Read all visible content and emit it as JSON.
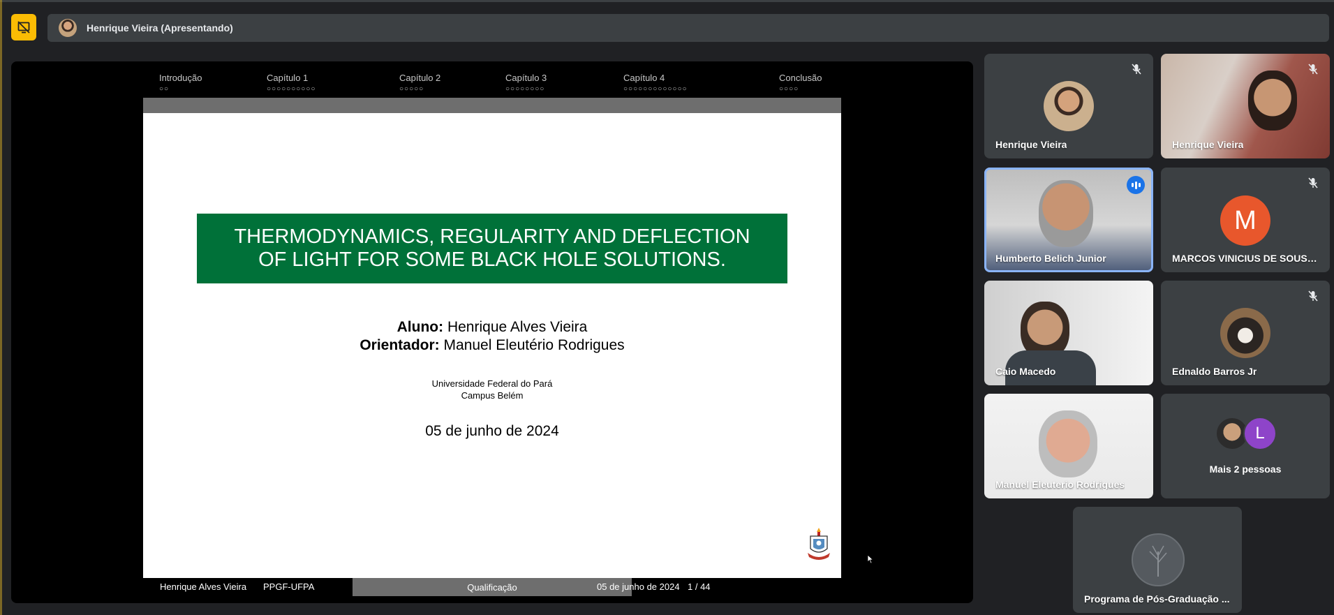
{
  "presenter": {
    "label": "Henrique Vieira (Apresentando)"
  },
  "colors": {
    "accent_yellow": "#fbbc04",
    "slide_green": "#007139",
    "active_border": "#8ab4f8",
    "speaking_blue": "#1a73e8",
    "avatar_m": "#e8572c",
    "avatar_l": "#8e44c9"
  },
  "slide": {
    "nav": [
      {
        "label": "Introdução",
        "dots": "○○"
      },
      {
        "label": "Capítulo 1",
        "dots": "○○○○○○○○○○"
      },
      {
        "label": "Capítulo 2",
        "dots": "○○○○○"
      },
      {
        "label": "Capítulo 3",
        "dots": "○○○○○○○○"
      },
      {
        "label": "Capítulo 4",
        "dots": "○○○○○○○○○○○○○"
      },
      {
        "label": "Conclusão",
        "dots": "○○○○"
      }
    ],
    "title_line1": "THERMODYNAMICS, REGULARITY AND DEFLECTION",
    "title_line2": "OF LIGHT FOR SOME BLACK HOLE SOLUTIONS.",
    "aluno_label": "Aluno:",
    "aluno_name": "Henrique Alves Vieira",
    "orientador_label": "Orientador:",
    "orientador_name": "Manuel Eleutério Rodrigues",
    "university": "Universidade Federal do Pará",
    "campus": "Campus Belém",
    "date": "05 de junho de 2024",
    "footer": {
      "author": "Henrique Alves Vieira",
      "program": "PPGF-UFPA",
      "section": "Qualificação",
      "date": "05 de junho de 2024",
      "page": "1 / 44"
    }
  },
  "participants": [
    {
      "name": "Henrique Vieira",
      "muted": true
    },
    {
      "name": "Henrique Vieira",
      "muted": true
    },
    {
      "name": "Humberto Belich Junior",
      "speaking": true
    },
    {
      "name": "MARCOS VINICIUS DE SOUSA...",
      "muted": true,
      "initial": "M"
    },
    {
      "name": "Caio Macedo"
    },
    {
      "name": "Ednaldo Barros Jr",
      "muted": true
    },
    {
      "name": "Manuel Eleuterio Rodrigues"
    },
    {
      "name": "Mais 2 pessoas",
      "initial": "L"
    },
    {
      "name": "Programa de Pós-Graduação ..."
    }
  ]
}
